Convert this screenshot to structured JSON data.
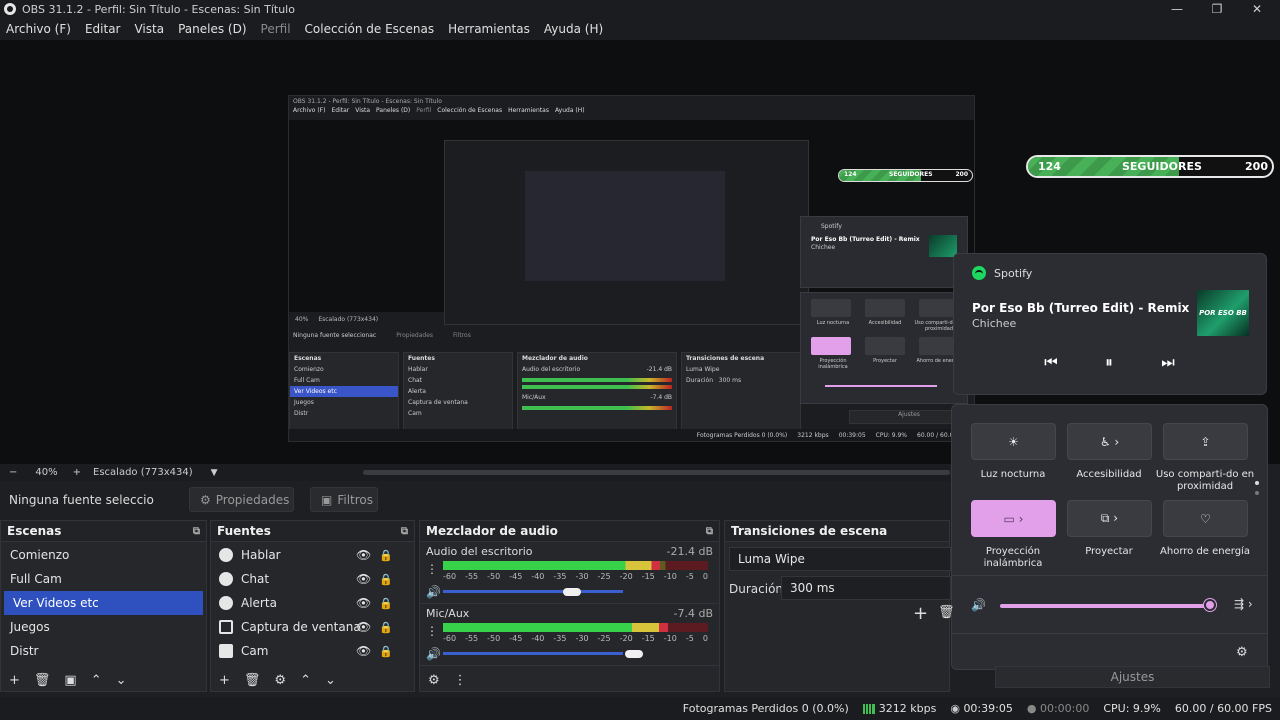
{
  "window": {
    "title": "OBS 31.1.2 - Perfil: Sin Título - Escenas: Sin Título",
    "minimize": "—",
    "maximize": "❐",
    "close": "✕"
  },
  "menu": [
    "Archivo (F)",
    "Editar",
    "Vista",
    "Paneles (D)",
    "Perfil",
    "Colección de Escenas",
    "Herramientas",
    "Ayuda (H)"
  ],
  "nested_preview": {
    "title": "OBS 31.1.2 - Perfil: Sin Título - Escenas: Sin Título",
    "menu": [
      "Archivo (F)",
      "Editar",
      "Vista",
      "Paneles (D)",
      "Perfil",
      "Colección de Escenas",
      "Herramientas",
      "Ayuda (H)"
    ],
    "zoom": "40%",
    "scale": "Escalado (773x434)",
    "no_source": "Ninguna fuente seleccionac",
    "props": "Propiedades",
    "filters": "Filtros",
    "scenes_title": "Escenas",
    "scenes": [
      "Comienzo",
      "Full Cam",
      "Ver Videos etc",
      "Juegos",
      "Distr"
    ],
    "sources_title": "Fuentes",
    "sources": [
      "Hablar",
      "Chat",
      "Alerta",
      "Captura de ventana",
      "Cam"
    ],
    "mixer_title": "Mezclador de audio",
    "mixer_ch1": "Audio del escritorio",
    "mixer_ch1_db": "-21.4 dB",
    "mixer_ch2": "Mic/Aux",
    "mixer_ch2_db": "-7.4 dB",
    "trans_title": "Transiciones de escena",
    "trans_value": "Luma Wipe",
    "duration_label": "Duración",
    "duration_value": "300 ms",
    "status_frames": "Fotogramas Perdidos 0 (0.0%)",
    "status_kbps": "3212 kbps",
    "status_time": "00:39:05",
    "status_cpu": "CPU: 9.9%",
    "status_fps": "60.00 / 60.00 FPS",
    "ajustes": "Ajustes",
    "follow_min": "124",
    "follow_label": "SEGUIDORES",
    "follow_max": "200",
    "spotify_label": "Spotify",
    "spotify_track": "Por Eso Bb (Turreo Edit) - Remix",
    "spotify_artist": "Chichee",
    "qs_labels": [
      "Luz nocturna",
      "Accesibilidad",
      "Uso comparti-do en proximidad",
      "Proyección inalámbrica",
      "Proyectar",
      "Ahorro de energía"
    ]
  },
  "followers": {
    "min": "124",
    "label": "SEGUIDORES",
    "max": "200",
    "progress": 0.62
  },
  "followers_small": {
    "min": "124",
    "label": "SEGUIDORES",
    "max": "200"
  },
  "spotify": {
    "app": "Spotify",
    "track": "Por Eso Bb (Turreo Edit) - Remix",
    "artist": "Chichee",
    "art_text": "POR ESO BB",
    "prev": "⏮",
    "pause": "⏸",
    "next": "⏭"
  },
  "quick_settings": {
    "tiles": [
      {
        "label": "Luz nocturna",
        "icon": "☀"
      },
      {
        "label": "Accesibilidad",
        "icon": "♿ ›"
      },
      {
        "label": "Uso comparti-do en proximidad",
        "icon": "⇪"
      },
      {
        "label": "Proyección inalámbrica",
        "icon": "▭ ›"
      },
      {
        "label": "Proyectar",
        "icon": "⧉ ›"
      },
      {
        "label": "Ahorro de energía",
        "icon": "♡"
      }
    ],
    "volume_icon": "🔊",
    "volume_level": 0.95,
    "audio_out_icon": "⇶ ›",
    "settings_icon": "⚙"
  },
  "toolbar": {
    "zoom_minus": "−",
    "zoom": "40%",
    "zoom_plus": "+",
    "scale": "Escalado (773x434)",
    "scale_arrow": "▼"
  },
  "props_bar": {
    "no_source": "Ninguna fuente seleccionac",
    "properties": "Propiedades",
    "filters": "Filtros"
  },
  "scenes": {
    "title": "Escenas",
    "items": [
      "Comienzo",
      "Full Cam",
      "Ver Videos etc",
      "Juegos",
      "Distr"
    ],
    "selected": 2
  },
  "sources": {
    "title": "Fuentes",
    "items": [
      "Hablar",
      "Chat",
      "Alerta",
      "Captura de ventana",
      "Cam"
    ]
  },
  "mixer": {
    "title": "Mezclador de audio",
    "channels": [
      {
        "name": "Audio del escritorio",
        "db": "-21.4 dB",
        "level": 0.82
      },
      {
        "name": "Mic/Aux",
        "db": "-7.4 dB",
        "level": 0.85
      }
    ],
    "scale": [
      "-60",
      "-55",
      "-50",
      "-45",
      "-40",
      "-35",
      "-30",
      "-25",
      "-20",
      "-15",
      "-10",
      "-5",
      "0"
    ]
  },
  "transitions": {
    "title": "Transiciones de escena",
    "value": "Luma Wipe",
    "duration_label": "Duración",
    "duration": "300 ms",
    "add": "+",
    "remove": "🗑"
  },
  "status": {
    "frames": "Fotogramas Perdidos 0 (0.0%)",
    "kbps": "3212 kbps",
    "rec_time": "00:39:05",
    "stream_time": "00:00:00",
    "cpu": "CPU: 9.9%",
    "fps": "60.00 / 60.00 FPS"
  },
  "ajustes": "Ajustes"
}
